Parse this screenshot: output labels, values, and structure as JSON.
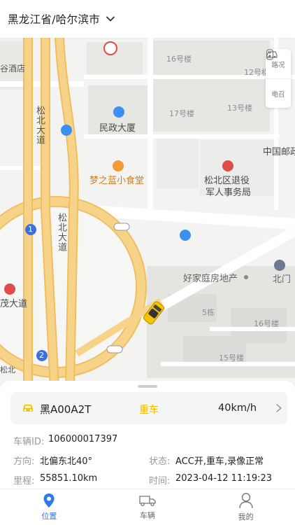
{
  "header": {
    "region": "黑龙江省/哈尔滨市",
    "dropdown_icon": "chevron-down-icon"
  },
  "map": {
    "controls": {
      "traffic_label": "路况",
      "charging_label": "电召"
    },
    "labels": {
      "hotel_partial": "谷酒店",
      "bldg16": "16号楼",
      "bldg12": "12号楼",
      "bldg17": "17号楼",
      "bldg13": "13号楼",
      "minzheng": "民政大厦",
      "post_partial": "中国邮政",
      "restaurant": "梦之蓝小食堂",
      "veterans_line1": "松北区退役",
      "veterans_line2": "军人事务局",
      "road1": "松北大道",
      "road2": "松北大道",
      "real_estate": "好家庭房地产",
      "north_gate": "北门",
      "bldg5": "5栋",
      "bldg16b": "16号楼",
      "bldg15": "15号楼",
      "street_partial": "茂大道",
      "metro_exit1": "1",
      "metro_exit2": "2",
      "songbei_partial": "松北"
    },
    "colors": {
      "road_major": "#f7d38a",
      "road_major_edge": "#efbe60",
      "building": "#e6e6e3",
      "background": "#f3f3f1",
      "taxi": "#f5c400",
      "poi_blue": "#3b8ff0",
      "poi_red": "#e04b4b",
      "poi_orange": "#f29b38"
    }
  },
  "vehicle": {
    "plate": "黑A00A2T",
    "status": "重车",
    "speed": "40km/h",
    "status_color": "#f2b900"
  },
  "details": {
    "id_label": "车辆ID:",
    "id_value": "106000017397",
    "direction_label": "方向:",
    "direction_value": "北偏东北40°",
    "state_label": "状态:",
    "state_value": "ACC开,重车,录像正常",
    "mileage_label": "里程:",
    "mileage_value": "55851.10km",
    "time_label": "时间:",
    "time_value": "2023-04-12 11:19:23"
  },
  "tabs": [
    {
      "label": "位置",
      "icon": "location-pin-icon",
      "active": true
    },
    {
      "label": "车辆",
      "icon": "truck-icon",
      "active": false
    },
    {
      "label": "我的",
      "icon": "user-icon",
      "active": false
    }
  ],
  "accent_color": "#2b7be9"
}
